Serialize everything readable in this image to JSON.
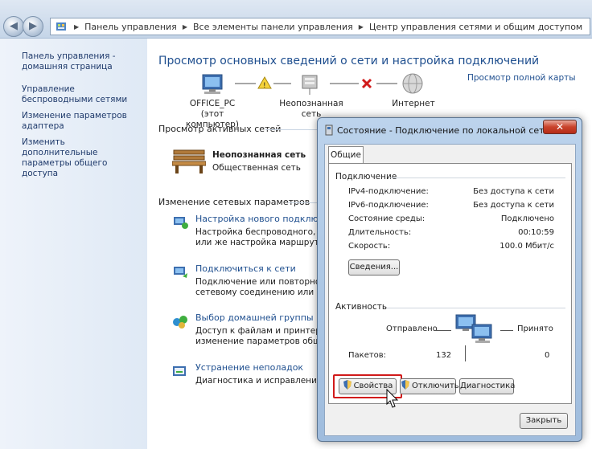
{
  "breadcrumb": [
    "Панель управления",
    "Все элементы панели управления",
    "Центр управления сетями и общим доступом"
  ],
  "sidebar": {
    "items": [
      {
        "label": "Панель управления - домашняя страница"
      },
      {
        "label": "Управление беспроводными сетями"
      },
      {
        "label": "Изменение параметров адаптера"
      },
      {
        "label": "Изменить дополнительные параметры общего доступа"
      }
    ]
  },
  "main": {
    "title": "Просмотр основных сведений о сети и настройка подключений",
    "full_map_link": "Просмотр полной карты",
    "map": {
      "computer": "OFFICE_PC",
      "computer_sub": "(этот компьютер)",
      "network": "Неопознанная сеть",
      "internet": "Интернет"
    },
    "active_networks_header": "Просмотр активных сетей",
    "network_name": "Неопознанная сеть",
    "network_type": "Общественная сеть",
    "change_settings_header": "Изменение сетевых параметров",
    "tasks": [
      {
        "title": "Настройка нового подключения",
        "desc1": "Настройка беспроводного, широ",
        "desc2": "или же настройка маршрутизато"
      },
      {
        "title": "Подключиться к сети",
        "desc1": "Подключение или повторное под",
        "desc2": "сетевому соединению или подк"
      },
      {
        "title": "Выбор домашней группы и пар",
        "desc1": "Доступ к файлам и принтерам, р",
        "desc2": "изменение параметров общего"
      },
      {
        "title": "Устранение неполадок",
        "desc1": "Диагностика и исправление сете",
        "desc2": ""
      }
    ]
  },
  "dialog": {
    "title": "Состояние - Подключение по локальной сети",
    "close": "✕",
    "tab": "Общие",
    "connection_group": "Подключение",
    "rows": [
      {
        "label": "IPv4-подключение:",
        "value": "Без доступа к сети"
      },
      {
        "label": "IPv6-подключение:",
        "value": "Без доступа к сети"
      },
      {
        "label": "Состояние среды:",
        "value": "Подключено"
      },
      {
        "label": "Длительность:",
        "value": "00:10:59"
      },
      {
        "label": "Скорость:",
        "value": "100.0 Мбит/с"
      }
    ],
    "details_button": "Сведения...",
    "activity_group": "Активность",
    "sent_label": "Отправлено",
    "received_label": "Принято",
    "packets_label": "Пакетов:",
    "packets_sent": "132",
    "packets_received": "0",
    "properties_button": "Свойства",
    "disable_button": "Отключить",
    "diagnostics_button": "Диагностика",
    "close_button": "Закрыть"
  },
  "colors": {
    "link": "#1f4f8f",
    "highlight": "#d11a1a"
  }
}
